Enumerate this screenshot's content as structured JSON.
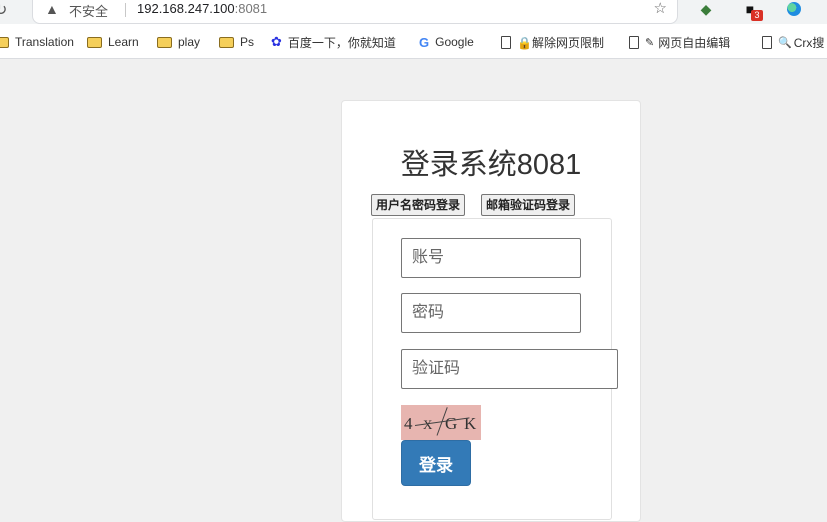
{
  "browser": {
    "security_label": "不安全",
    "url_host": "192.168.247.100",
    "url_port": ":8081",
    "extension_badge": "3"
  },
  "bookmarks": [
    {
      "label": "Translation",
      "icon": "folder-icon"
    },
    {
      "label": "Learn",
      "icon": "folder-icon"
    },
    {
      "label": "play",
      "icon": "folder-icon"
    },
    {
      "label": "Ps",
      "icon": "folder-icon"
    },
    {
      "label": "百度一下，你就知道",
      "icon": "baidu-paw-icon"
    },
    {
      "label": "Google",
      "icon": "google-icon"
    },
    {
      "label": "🔒解除网页限制",
      "icon": "page-icon"
    },
    {
      "label": "网页自由编辑",
      "icon": "page-icon"
    },
    {
      "label": "Crx搜",
      "icon": "page-icon"
    }
  ],
  "page": {
    "title": "登录系统8081",
    "tabs": {
      "password_login": "用户名密码登录",
      "email_login": "邮箱验证码登录"
    },
    "form": {
      "account_placeholder": "账号",
      "password_placeholder": "密码",
      "captcha_placeholder": "验证码",
      "captcha_image_text": "4XGK",
      "submit_label": "登录"
    }
  },
  "colors": {
    "primary_button": "#337ab7",
    "captcha_bg": "#e7b5b0",
    "page_bg": "#f0f0f0"
  }
}
